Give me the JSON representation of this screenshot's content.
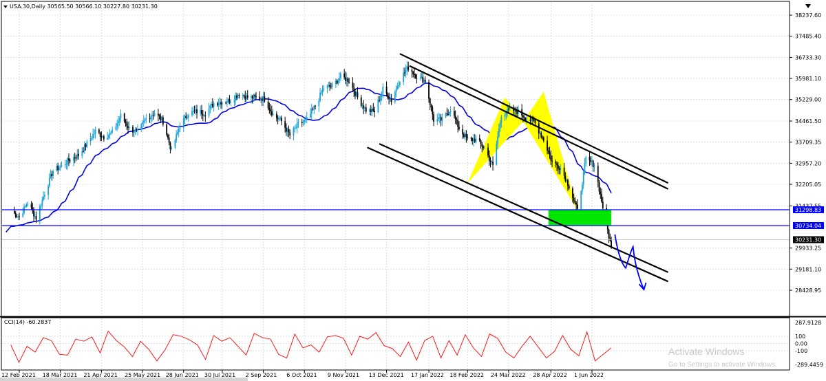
{
  "header": {
    "symbol_line": "USA.30,Daily  30565.50 30566.10 30227.80 30231.30"
  },
  "indicator": {
    "label": "CCI(14) -60.2837",
    "axis_labels": [
      "287.9128",
      "100",
      "0.00",
      "-100",
      "-289.4459"
    ]
  },
  "chart_data": [
    {
      "type": "candlestick",
      "symbol": "USA.30",
      "timeframe": "Daily",
      "ohlc_last": {
        "open": 30565.5,
        "high": 30566.1,
        "low": 30227.8,
        "close": 30231.3
      },
      "y_ticks": [
        38237.6,
        37485.4,
        36733.3,
        35981.1,
        35229.0,
        34461.5,
        33709.35,
        32957.2,
        32205.05,
        31437.55,
        29933.25,
        29181.1,
        28428.95
      ],
      "y_tick_labels": [
        "38237.60",
        "37485.40",
        "36733.30",
        "35981.10",
        "35229.00",
        "34461.50",
        "33709.35",
        "32957.20",
        "32205.05",
        "31437.55",
        "29933.25",
        "29181.10",
        "28428.95"
      ],
      "ylim": [
        28300,
        38650
      ],
      "x_tick_labels": [
        "12 Feb 2021",
        "18 Mar 2021",
        "21 Apr 2021",
        "25 May 2021",
        "28 Jun 2021",
        "30 Jul 2021",
        "2 Sep 2021",
        "6 Oct 2021",
        "9 Nov 2021",
        "13 Dec 2021",
        "17 Jan 2022",
        "18 Feb 2022",
        "24 Mar 2022",
        "28 Apr 2022",
        "1 Jun 2022"
      ],
      "price_path_dates": [
        "2021-02-05",
        "2021-02-12",
        "2021-02-19",
        "2021-02-26",
        "2021-03-05",
        "2021-03-12",
        "2021-03-19",
        "2021-03-26",
        "2021-04-02",
        "2021-04-09",
        "2021-04-16",
        "2021-04-23",
        "2021-04-30",
        "2021-05-07",
        "2021-05-14",
        "2021-05-21",
        "2021-05-28",
        "2021-06-04",
        "2021-06-11",
        "2021-06-18",
        "2021-06-25",
        "2021-07-02",
        "2021-07-09",
        "2021-07-16",
        "2021-07-23",
        "2021-07-30",
        "2021-08-06",
        "2021-08-13",
        "2021-08-20",
        "2021-08-27",
        "2021-09-03",
        "2021-09-10",
        "2021-09-17",
        "2021-09-24",
        "2021-10-01",
        "2021-10-08",
        "2021-10-15",
        "2021-10-22",
        "2021-10-29",
        "2021-11-05",
        "2021-11-12",
        "2021-11-19",
        "2021-11-26",
        "2021-12-03",
        "2021-12-10",
        "2021-12-17",
        "2021-12-24",
        "2021-12-31",
        "2022-01-07",
        "2022-01-14",
        "2022-01-21",
        "2022-01-28",
        "2022-02-04",
        "2022-02-11",
        "2022-02-18",
        "2022-02-25",
        "2022-03-04",
        "2022-03-11",
        "2022-03-18",
        "2022-03-25",
        "2022-04-01",
        "2022-04-08",
        "2022-04-14",
        "2022-04-22",
        "2022-04-29",
        "2022-05-06",
        "2022-05-13",
        "2022-05-20",
        "2022-05-27",
        "2022-06-03",
        "2022-06-10",
        "2022-06-17"
      ],
      "price_path_closes": [
        31250,
        31050,
        31550,
        31000,
        31900,
        32700,
        32850,
        33100,
        33250,
        33650,
        34100,
        33900,
        34050,
        34650,
        34200,
        34050,
        34550,
        34750,
        34450,
        33400,
        34300,
        34750,
        34800,
        34750,
        35100,
        35150,
        35200,
        35450,
        35300,
        35300,
        35250,
        34700,
        34450,
        33950,
        34350,
        34500,
        35000,
        35650,
        35700,
        36050,
        35900,
        35300,
        34850,
        34800,
        35600,
        35200,
        35950,
        36380,
        36050,
        35900,
        34500,
        34500,
        34900,
        34200,
        33800,
        33800,
        33500,
        32850,
        34700,
        34850,
        34800,
        34550,
        34450,
        33800,
        33000,
        32800,
        32150,
        31250,
        33100,
        32900,
        31400,
        29950
      ],
      "moving_average": {
        "from": 30700,
        "peak": 35950,
        "peak_date": "2022-01-03",
        "last": 32750
      },
      "horizontal_levels": [
        {
          "value": 31298.83,
          "label": "31298.83"
        },
        {
          "value": 30734.04,
          "label": "30734.04"
        },
        {
          "value": 30231.3,
          "label": "30231.30",
          "current": true
        }
      ],
      "support_zone": {
        "from": 30734.04,
        "to": 31298.83,
        "start": "2022-04-26",
        "end": "2022-06-17",
        "color": "#00e600"
      },
      "upper_channel": [
        {
          "start": "2022-01-01",
          "start_value": 36430,
          "end": "2022-08-03",
          "end_value": 32040
        },
        {
          "start": "2021-12-24",
          "start_value": 36860,
          "end": "2022-08-03",
          "end_value": 32250
        }
      ],
      "lower_channel": [
        {
          "start": "2021-11-27",
          "start_value": 33520,
          "end": "2022-08-03",
          "end_value": 28740
        },
        {
          "start": "2021-12-07",
          "start_value": 33650,
          "end": "2022-08-03",
          "end_value": 29070
        }
      ],
      "harmonic_pattern": {
        "color": "#ffff00",
        "points": [
          {
            "date": "2022-02-18",
            "value": 32250
          },
          {
            "date": "2022-03-21",
            "value": 35300
          },
          {
            "date": "2022-04-05",
            "value": 34450
          },
          {
            "date": "2022-04-22",
            "value": 35500
          },
          {
            "date": "2022-05-20",
            "value": 31300
          }
        ]
      },
      "projection": {
        "color": "#0000ff",
        "points": [
          {
            "date": "2022-06-20",
            "value": 30420
          },
          {
            "date": "2022-06-29",
            "value": 29220
          },
          {
            "date": "2022-07-05",
            "value": 29980
          },
          {
            "date": "2022-07-14",
            "value": 28450
          }
        ]
      }
    },
    {
      "type": "line",
      "name": "CCI(14)",
      "current": -60.2837,
      "y_ticks": [
        287.9128,
        100,
        0,
        -100,
        -289.4459
      ],
      "ylim": [
        -289.4459,
        287.9128
      ],
      "color": "#ff0000",
      "values": [
        -20,
        -260,
        -40,
        -120,
        80,
        40,
        -150,
        -160,
        60,
        30,
        90,
        -130,
        170,
        40,
        -50,
        -180,
        30,
        -80,
        -240,
        -90,
        120,
        100,
        50,
        -20,
        -220,
        110,
        30,
        80,
        -40,
        -160,
        140,
        80,
        60,
        -150,
        -200,
        130,
        -60,
        -20,
        -120,
        90,
        110,
        70,
        -160,
        100,
        60,
        150,
        -30,
        -70,
        -180,
        20,
        -230,
        40,
        100,
        -200,
        40,
        -160,
        120,
        -60,
        -180,
        130,
        70,
        -120,
        -200,
        -40,
        100,
        -50,
        -200,
        -110,
        110,
        -80,
        -170,
        160,
        -240,
        -150,
        -60
      ]
    }
  ],
  "watermark": {
    "title": "Activate Windows",
    "subtitle": "Go to Settings to activate Windows."
  }
}
